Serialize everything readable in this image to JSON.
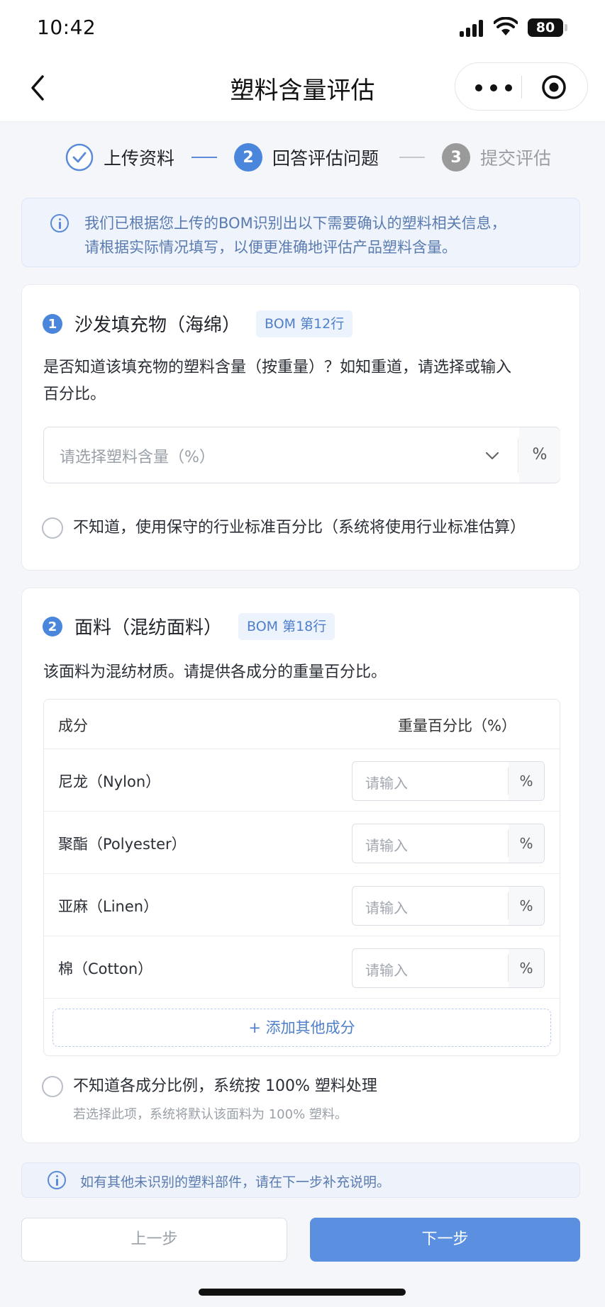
{
  "status_bar": {
    "time": "10:42",
    "battery": "80"
  },
  "nav": {
    "title": "塑料含量评估"
  },
  "steps": [
    {
      "label": "上传资料",
      "number": "1",
      "state": "done"
    },
    {
      "label": "回答评估问题",
      "number": "2",
      "state": "active"
    },
    {
      "label": "提交评估",
      "number": "3",
      "state": "pending"
    }
  ],
  "notice": {
    "line1": "我们已根据您上传的BOM识别出以下需要确认的塑料相关信息，",
    "line2": "请根据实际情况填写，以便更准确地评估产品塑料含量。"
  },
  "card1": {
    "number": "1",
    "title": "沙发填充物（海绵）",
    "bom_tag": "BOM 第12行",
    "question_line1": "是否知道该填充物的塑料含量（按重量）？如知重道，请选择或输入",
    "question_line2": "百分比。",
    "select_placeholder": "请选择塑料含量（%）",
    "select_unit": "%",
    "unknown_option": "不知道，使用保守的行业标准百分比（系统将使用行业标准估算）"
  },
  "card2": {
    "number": "2",
    "title": "面料（混纺面料）",
    "bom_tag": "BOM 第18行",
    "question": "该面料为混纺材质。请提供各成分的重量百分比。",
    "table_header": {
      "component": "成分",
      "percentage": "重量百分比（%）"
    },
    "components": [
      {
        "name": "尼龙（Nylon）",
        "placeholder": "请输入",
        "unit": "%"
      },
      {
        "name": "聚酯（Polyester）",
        "placeholder": "请输入",
        "unit": "%"
      },
      {
        "name": "亚麻（Linen）",
        "placeholder": "请输入",
        "unit": "%"
      },
      {
        "name": "棉（Cotton）",
        "placeholder": "请输入",
        "unit": "%"
      }
    ],
    "add_button": "+  添加其他成分",
    "unknown_option": "不知道各成分比例，系统按 100% 塑料处理",
    "unknown_hint": "若选择此项，系统将默认该面料为 100% 塑料。"
  },
  "bottom_notice": "如有其他未识别的塑料部件，请在下一步补充说明。",
  "buttons": {
    "prev": "上一步",
    "next": "下一步"
  },
  "colors": {
    "accent": "#4a86db",
    "primary_button": "#5b8fe0",
    "page_bg": "#f4f6fa",
    "step_pending": "#9a9a9a"
  }
}
